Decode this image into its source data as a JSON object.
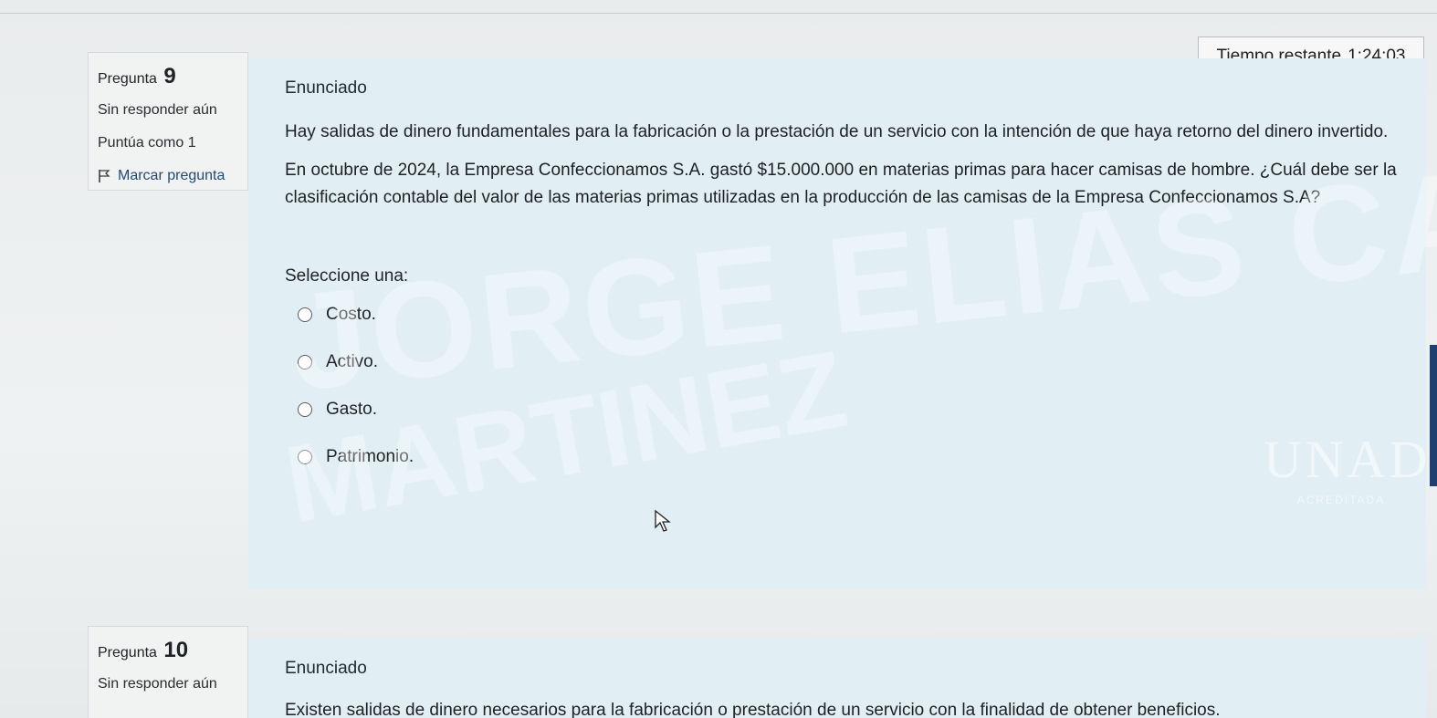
{
  "timer": {
    "label": "Tiempo restante",
    "value": "1:24:03"
  },
  "questions": [
    {
      "label": "Pregunta",
      "number": "9",
      "status": "Sin responder aún",
      "points": "Puntúa como 1",
      "flag": "Marcar pregunta",
      "heading": "Enunciado",
      "paragraphs": [
        "Hay salidas de dinero fundamentales para la fabricación o la prestación de un servicio con la intención de que haya retorno del dinero invertido.",
        "En octubre de 2024, la Empresa Confeccionamos S.A. gastó $15.000.000 en materias primas para hacer camisas de hombre. ¿Cuál debe ser la clasificación contable del valor de las materias primas utilizadas en la producción de las camisas de la Empresa Confeccionamos S.A?"
      ],
      "select_label": "Seleccione una:",
      "options": [
        "Costo.",
        "Activo.",
        "Gasto.",
        "Patrimonio."
      ]
    },
    {
      "label": "Pregunta",
      "number": "10",
      "status": "Sin responder aún",
      "heading": "Enunciado",
      "paragraph": "Existen salidas de dinero necesarios para la fabricación o prestación de un servicio con la finalidad de obtener beneficios."
    }
  ],
  "watermark": {
    "line1": "JORGE ELIAS CARMONA",
    "line2": "MARTINEZ"
  },
  "logo": {
    "mark": "UNAD",
    "tagline": "ACREDITADA"
  },
  "colors": {
    "content_bg": "#e1eff4",
    "info_bg": "#f1f2f2",
    "link": "#214a72",
    "right_bar": "#1f3f73"
  }
}
